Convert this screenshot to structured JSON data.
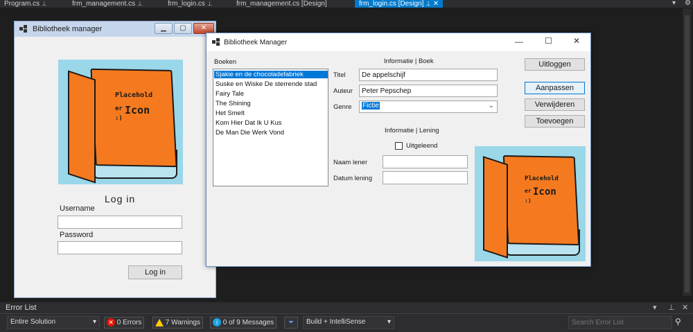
{
  "ide_tabs": [
    {
      "label": "Program.cs"
    },
    {
      "label": "frm_management.cs"
    },
    {
      "label": "frm_login.cs"
    },
    {
      "label": "frm_management.cs [Design]"
    },
    {
      "label": "frm_login.cs [Design]"
    }
  ],
  "active_tab_index": 4,
  "login_window": {
    "title": "Bibliotheek manager",
    "placeholder_line1": "Placehold",
    "placeholder_line2": "er",
    "placeholder_line3": "Icon",
    "placeholder_line4": ":)",
    "heading": "Log in",
    "username_label": "Username",
    "username_value": "",
    "password_label": "Password",
    "password_value": "",
    "login_button": "Log in"
  },
  "main_window": {
    "title": "Bibliotheek Manager",
    "books_label": "Boeken",
    "books": [
      "Sjakie en de chocoladefabriek",
      "Suske en Wiske De sterrende stad",
      "Fairy Tale",
      "The Shining",
      "Het Smelt",
      "Kom Hier Dat Ik U Kus",
      "De Man Die Werk Vond"
    ],
    "selected_book_index": 0,
    "info_book_header": "Informatie | Boek",
    "title_label": "Titel",
    "title_value": "De appelschijf",
    "author_label": "Auteur",
    "author_value": "Peter Pepschep",
    "genre_label": "Genre",
    "genre_value": "Fictie",
    "info_loan_header": "Informatie | Lening",
    "lent_checkbox_label": "Uitgeleend",
    "lent_checked": false,
    "borrower_label": "Naam lener",
    "borrower_value": "",
    "loan_date_label": "Datum lening",
    "loan_date_value": "",
    "buttons": {
      "logout": "Uitloggen",
      "edit": "Aanpassen",
      "delete": "Verwijderen",
      "add": "Toevoegen"
    },
    "placeholder_line1": "Placehold",
    "placeholder_line2": "er",
    "placeholder_line3": "Icon",
    "placeholder_line4": ":)"
  },
  "error_list": {
    "title": "Error List",
    "scope": "Entire Solution",
    "errors": "0 Errors",
    "warnings": "7 Warnings",
    "messages": "0 of 9 Messages",
    "build_filter": "Build + IntelliSense",
    "search_placeholder": "Search Error List"
  },
  "colors": {
    "accent": "#007acc",
    "selection": "#0078d7",
    "placeholder_bg": "#9ad7e8",
    "book_orange": "#f57a1f"
  }
}
